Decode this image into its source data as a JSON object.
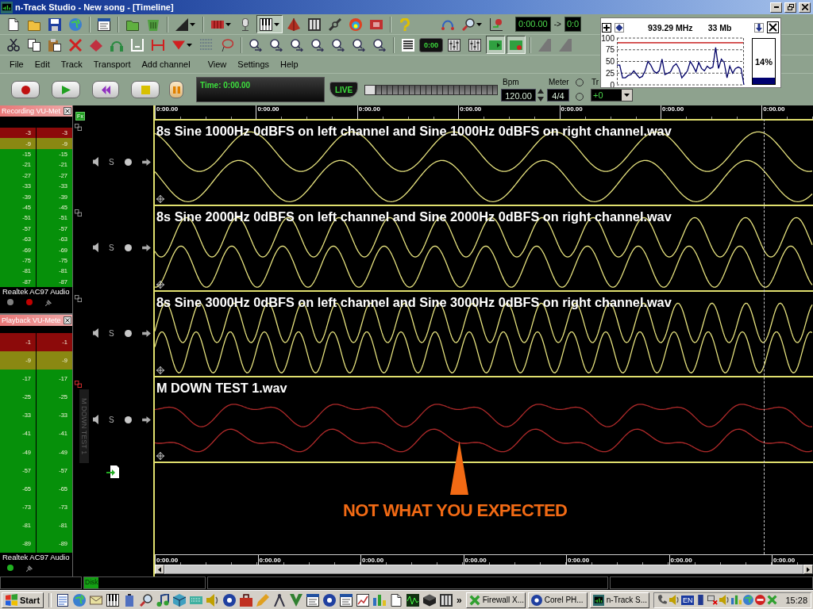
{
  "window": {
    "title": "n-Track Studio - New song - [Timeline]"
  },
  "toolbar_1": {
    "buttons": [
      {
        "pressed": false
      },
      {
        "pressed": false
      },
      {
        "pressed": false
      },
      {
        "pressed": false
      },
      {
        "pressed": false
      },
      {
        "pressed": false
      },
      {
        "pressed": false
      },
      {
        "pressed": false
      },
      {
        "pressed": false
      },
      {
        "pressed": false
      },
      {
        "pressed": true
      },
      {
        "pressed": false
      },
      {
        "pressed": false
      },
      {
        "pressed": false
      },
      {
        "pressed": false
      },
      {
        "pressed": false
      },
      {
        "pressed": false
      },
      {
        "pressed": false
      },
      {
        "pressed": false
      },
      {
        "pressed": false
      }
    ],
    "time_fields": [
      "0:00.00",
      "0:0"
    ],
    "range_arrow": "->"
  },
  "toolbar_2": {
    "buttons": [
      {
        "pressed": false
      },
      {
        "pressed": false
      },
      {
        "pressed": false
      },
      {
        "pressed": false
      },
      {
        "pressed": false
      },
      {
        "pressed": false
      },
      {
        "pressed": false
      },
      {
        "pressed": false
      },
      {
        "pressed": false
      },
      {
        "pressed": false
      },
      {
        "pressed": false
      },
      {
        "pressed": false
      },
      {
        "pressed": false
      },
      {
        "pressed": false
      },
      {
        "pressed": false
      },
      {
        "pressed": false
      },
      {
        "pressed": false
      },
      {
        "pressed": false
      },
      {
        "pressed": false
      },
      {
        "label": "0:00",
        "pressed": false
      },
      {
        "pressed": false
      },
      {
        "pressed": false
      },
      {
        "pressed": true
      },
      {
        "pressed": true
      },
      {
        "pressed": false
      },
      {
        "pressed": false
      }
    ]
  },
  "menu": [
    "File",
    "Edit",
    "Track",
    "Transport",
    "Add channel",
    "View",
    "Settings",
    "Help"
  ],
  "transport": {
    "time": "Time: 0:00.00",
    "live": "LIVE",
    "position": {
      "level": 0
    },
    "bpm": {
      "label": "Bpm",
      "value": "120.00"
    },
    "meter": {
      "label": "Meter",
      "value": "4/4"
    },
    "modes": [
      {
        "selected": false
      },
      {
        "selected": false
      }
    ],
    "transpose": {
      "label": "Tr",
      "value": "+0"
    }
  },
  "cpu_monitor": {
    "frequency": "939.29 MHz",
    "memory": "33 Mb",
    "chart_data": {
      "type": "line",
      "ylim": [
        0,
        100
      ],
      "yticks": [
        0,
        25,
        50,
        75,
        100
      ],
      "grid": true,
      "series": [
        {
          "color": "#000066",
          "values": [
            42,
            42,
            15,
            15,
            20,
            22,
            30,
            22,
            15,
            18,
            30,
            50,
            42,
            30,
            25,
            30,
            55,
            22,
            25,
            28,
            40,
            45,
            35,
            15,
            22,
            30,
            50,
            40,
            28,
            48,
            35,
            30,
            40,
            35,
            38,
            80,
            35,
            55,
            48,
            15,
            40,
            25,
            35,
            38,
            35,
            0
          ]
        }
      ],
      "ref_lines": [
        {
          "axis": "y",
          "value": 90,
          "color": "#d04040"
        }
      ]
    },
    "usage": {
      "level": 0.14,
      "reading": "14%"
    }
  },
  "recording_meter": {
    "title": "Recording VU-Met",
    "channels": [
      {
        "marks": [
          "-3",
          "-9",
          "-15",
          "-21",
          "-27",
          "-33",
          "-39",
          "-45",
          "-51",
          "-57",
          "-63",
          "-69",
          "-75",
          "-81",
          "-87"
        ]
      },
      {
        "marks": [
          "-3",
          "-9",
          "-15",
          "-21",
          "-27",
          "-33",
          "-39",
          "-45",
          "-51",
          "-57",
          "-63",
          "-69",
          "-75",
          "-81",
          "-87"
        ]
      }
    ],
    "device": "Realtek AC97 Audio",
    "indicators": [
      {
        "color": "#808080"
      },
      {
        "color": "#c00000"
      }
    ]
  },
  "playback_meter": {
    "title": "Playback VU-Mete",
    "channels": [
      {
        "marks": [
          "-1",
          "-9",
          "-17",
          "-25",
          "-33",
          "-41",
          "-49",
          "-57",
          "-65",
          "-73",
          "-81",
          "-89"
        ]
      },
      {
        "marks": [
          "-1",
          "-9",
          "-17",
          "-25",
          "-33",
          "-41",
          "-49",
          "-57",
          "-65",
          "-73",
          "-81",
          "-89"
        ]
      }
    ],
    "device": "Realtek AC97 Audio",
    "indicators": [
      {
        "color": "#20b020"
      }
    ]
  },
  "track_panel": {
    "fx": "Fx"
  },
  "timeline": {
    "ruler_top": [
      "0:00.00",
      "0:00.00",
      "0:00.00",
      "0:00.00",
      "0:00.00",
      "0:00.00",
      "0:00.00"
    ],
    "tracks": [
      {
        "name": "8s Sine 1000Hz 0dBFS on left channel and Sine 1000Hz 0dBFS on right channel.wav",
        "color": "#e6e27e",
        "solo": "S",
        "selected": false
      },
      {
        "name": "8s Sine 2000Hz 0dBFS on left channel and Sine 2000Hz 0dBFS on right channel.wav",
        "color": "#e6e27e",
        "solo": "S",
        "selected": false
      },
      {
        "name": "8s Sine 3000Hz 0dBFS on left channel and Sine 3000Hz 0dBFS on right channel.wav",
        "color": "#e6e27e",
        "solo": "S",
        "selected": false
      },
      {
        "name": "M DOWN TEST 1.wav",
        "color": "#b02a2a",
        "solo": "S",
        "selected": true,
        "side_label": "M DOWN TEST 1"
      }
    ],
    "ruler_bottom": [
      "0:00.00",
      "0:00.00",
      "0:00.00",
      "0:00.00",
      "0:00.00",
      "0:00.00",
      "0:00.00"
    ],
    "annotation": "NOT WHAT YOU EXPECTED"
  },
  "status_bar": {
    "disk": {
      "label": "Disk",
      "level": 0.12
    }
  },
  "taskbar": {
    "start": "Start",
    "more": "»",
    "tasks": [
      {
        "label": "Firewall X...",
        "selected": false
      },
      {
        "label": "Corel PH...",
        "selected": false
      },
      {
        "label": "n-Track S...",
        "selected": false
      }
    ],
    "language": "EN",
    "clock": "15:28"
  }
}
